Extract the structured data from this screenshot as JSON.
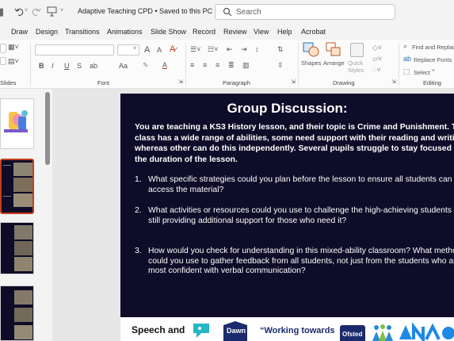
{
  "titlebar": {
    "doc_title": "Adaptive Teaching CPD • Saved to this PC",
    "search_placeholder": "Search"
  },
  "menu_tabs": [
    "Draw",
    "Design",
    "Transitions",
    "Animations",
    "Slide Show",
    "Record",
    "Review",
    "View",
    "Help",
    "Acrobat"
  ],
  "ribbon": {
    "groups": {
      "slides": "Slides",
      "font": "Font",
      "paragraph": "Paragraph",
      "drawing": "Drawing",
      "editing": "Editing"
    },
    "font_buttons": {
      "bold": "B",
      "italic": "I",
      "underline": "U",
      "strike": "S",
      "case": "Aa",
      "grow": "A",
      "shrink": "A"
    },
    "drawing_buttons": {
      "shapes": "Shapes",
      "arrange": "Arrange",
      "quick_styles": "Quick Styles"
    },
    "editing_buttons": {
      "find": "Find and Replace",
      "replace": "Replace Fonts",
      "select": "Select"
    }
  },
  "slide": {
    "title": "Group Discussion:",
    "intro": "You are teaching a KS3 History lesson, and their topic is Crime and Punishment. The class has a wide range of abilities, some need support with their reading and writing, whereas other can do this independently. Several pupils struggle to stay focused for the duration of the lesson.",
    "questions": [
      {
        "num": "1.",
        "text": "What specific strategies could you plan before the lesson to ensure all students can access the material?"
      },
      {
        "num": "2.",
        "text": "What activities or resources could you use to challenge the high-achieving students while still providing additional support for those who need it?"
      },
      {
        "num": "3.",
        "text": "How would you check for understanding in this mixed-ability classroom? What methods could you use to gather feedback from all students, not just from the students who are most confident with verbal communication?"
      }
    ],
    "footer": {
      "logo1": "Speech and",
      "logo2": "Dawn",
      "quote": "“Working towards",
      "logo3": "Ofsted"
    }
  },
  "colors": {
    "slide_bg": "#0e0c28",
    "selected_thumb": "#c43e1c",
    "accent": "#c43e1c"
  }
}
